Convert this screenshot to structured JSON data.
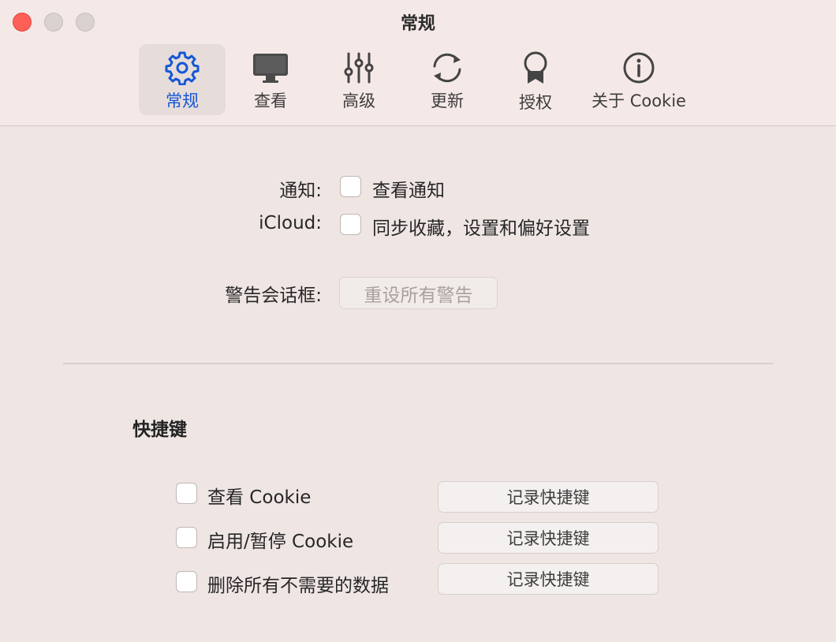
{
  "window": {
    "title": "常规"
  },
  "toolbar": {
    "items": [
      {
        "label": "常规",
        "icon": "gear-icon",
        "selected": true
      },
      {
        "label": "查看",
        "icon": "monitor-icon",
        "selected": false
      },
      {
        "label": "高级",
        "icon": "sliders-icon",
        "selected": false
      },
      {
        "label": "更新",
        "icon": "refresh-icon",
        "selected": false
      },
      {
        "label": "授权",
        "icon": "badge-icon",
        "selected": false
      },
      {
        "label": "关于 Cookie",
        "icon": "info-icon",
        "selected": false
      }
    ]
  },
  "general": {
    "notification_label": "通知:",
    "notification_checkbox": "查看通知",
    "notification_checked": false,
    "icloud_label": "iCloud:",
    "icloud_checkbox": "同步收藏，设置和偏好设置",
    "icloud_checked": false,
    "alerts_label": "警告会话框:",
    "reset_alerts_button": "重设所有警告"
  },
  "shortcuts": {
    "title": "快捷键",
    "rows": [
      {
        "label": "查看 Cookie",
        "checked": false,
        "button": "记录快捷键"
      },
      {
        "label": "启用/暂停 Cookie",
        "checked": false,
        "button": "记录快捷键"
      },
      {
        "label": "删除所有不需要的数据",
        "checked": false,
        "button": "记录快捷键"
      }
    ]
  },
  "colors": {
    "accent": "#1457d6",
    "close": "#fe5f57"
  }
}
